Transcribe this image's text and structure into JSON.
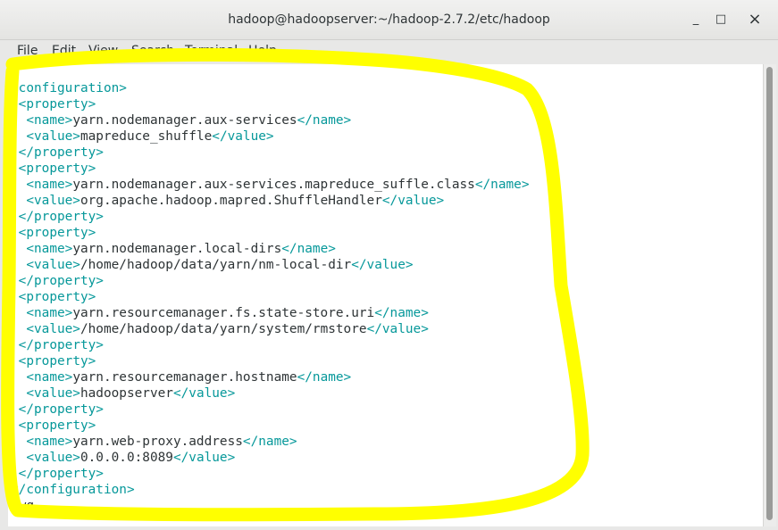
{
  "window": {
    "title": "hadoop@hadoopserver:~/hadoop-2.7.2/etc/hadoop",
    "min_glyph": "_",
    "max_glyph": "□",
    "close_glyph": "×"
  },
  "menu": [
    "File",
    "Edit",
    "View",
    "Search",
    "Terminal",
    "Help"
  ],
  "lines": [
    {
      "i": "",
      "o": "<configuration>",
      "t": "",
      "c": ""
    },
    {
      "i": " ",
      "o": "<property>",
      "t": "",
      "c": ""
    },
    {
      "i": "  ",
      "o": "<name>",
      "t": "yarn.nodemanager.aux-services",
      "c": "</name>"
    },
    {
      "i": "  ",
      "o": "<value>",
      "t": "mapreduce_shuffle",
      "c": "</value>"
    },
    {
      "i": " ",
      "o": "</property>",
      "t": "",
      "c": ""
    },
    {
      "i": " ",
      "o": "<property>",
      "t": "",
      "c": ""
    },
    {
      "i": "  ",
      "o": "<name>",
      "t": "yarn.nodemanager.aux-services.mapreduce_suffle.class",
      "c": "</name>"
    },
    {
      "i": "  ",
      "o": "<value>",
      "t": "org.apache.hadoop.mapred.ShuffleHandler",
      "c": "</value>"
    },
    {
      "i": " ",
      "o": "</property>",
      "t": "",
      "c": ""
    },
    {
      "i": " ",
      "o": "<property>",
      "t": "",
      "c": ""
    },
    {
      "i": "  ",
      "o": "<name>",
      "t": "yarn.nodemanager.local-dirs",
      "c": "</name>"
    },
    {
      "i": "  ",
      "o": "<value>",
      "t": "/home/hadoop/data/yarn/nm-local-dir",
      "c": "</value>"
    },
    {
      "i": " ",
      "o": "</property>",
      "t": "",
      "c": ""
    },
    {
      "i": " ",
      "o": "<property>",
      "t": "",
      "c": ""
    },
    {
      "i": "  ",
      "o": "<name>",
      "t": "yarn.resourcemanager.fs.state-store.uri",
      "c": "</name>"
    },
    {
      "i": "  ",
      "o": "<value>",
      "t": "/home/hadoop/data/yarn/system/rmstore",
      "c": "</value>"
    },
    {
      "i": " ",
      "o": "</property>",
      "t": "",
      "c": ""
    },
    {
      "i": " ",
      "o": "<property>",
      "t": "",
      "c": ""
    },
    {
      "i": "  ",
      "o": "<name>",
      "t": "yarn.resourcemanager.hostname",
      "c": "</name>"
    },
    {
      "i": "  ",
      "o": "<value>",
      "t": "hadoopserver",
      "c": "</value>"
    },
    {
      "i": " ",
      "o": "</property>",
      "t": "",
      "c": ""
    },
    {
      "i": " ",
      "o": "<property>",
      "t": "",
      "c": ""
    },
    {
      "i": "  ",
      "o": "<name>",
      "t": "yarn.web-proxy.address",
      "c": "</name>"
    },
    {
      "i": "  ",
      "o": "<value>",
      "t": "0.0.0.0:8089",
      "c": "</value>"
    },
    {
      "i": " ",
      "o": "</property>",
      "t": "",
      "c": ""
    },
    {
      "i": "",
      "o": "</configuration>",
      "t": "",
      "c": ""
    }
  ],
  "command_line": ":wq",
  "colors": {
    "tag": "#06989a",
    "text": "#2e3436",
    "highlight": "#ffff00"
  }
}
